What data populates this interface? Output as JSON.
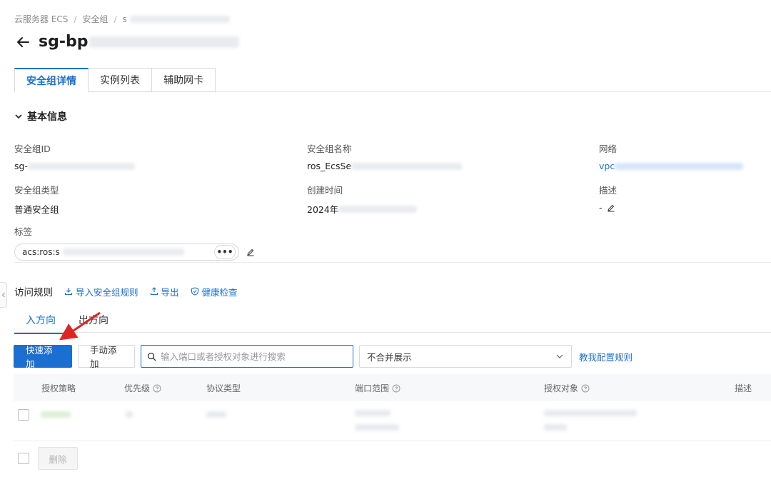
{
  "breadcrumb": {
    "item1": "云服务器 ECS",
    "sep": "/",
    "item2": "安全组",
    "item3": "s"
  },
  "title": "sg-bp",
  "tabs": [
    {
      "label": "安全组详情"
    },
    {
      "label": "实例列表"
    },
    {
      "label": "辅助网卡"
    }
  ],
  "basic": {
    "heading": "基本信息",
    "fields": {
      "id": {
        "label": "安全组ID",
        "value": "sg-"
      },
      "name": {
        "label": "安全组名称",
        "value": "ros_EcsSe"
      },
      "network": {
        "label": "网络",
        "value": "vpc"
      },
      "type": {
        "label": "安全组类型",
        "value": "普通安全组"
      },
      "created": {
        "label": "创建时间",
        "value": "2024年"
      },
      "desc": {
        "label": "描述",
        "value": "-"
      },
      "tags": {
        "label": "标签",
        "value": "acs:ros:s",
        "more": "•••"
      }
    }
  },
  "rules": {
    "title": "访问规则",
    "links": {
      "import": "导入安全组规则",
      "export": "导出",
      "health": "健康检查"
    },
    "directions": {
      "in": "入方向",
      "out": "出方向"
    },
    "toolbar": {
      "quick_add": "快速添加",
      "manual_add": "手动添加",
      "search_placeholder": "输入端口或者授权对象进行搜索",
      "select_value": "不合并展示",
      "help": "教我配置规则"
    },
    "columns": {
      "policy": "授权策略",
      "priority": "优先级",
      "protocol": "协议类型",
      "port": "端口范围",
      "source": "授权对象",
      "desc": "描述"
    },
    "delete": "删除"
  },
  "colors": {
    "accent": "#1a6fd1",
    "annotation": "#e02424"
  }
}
